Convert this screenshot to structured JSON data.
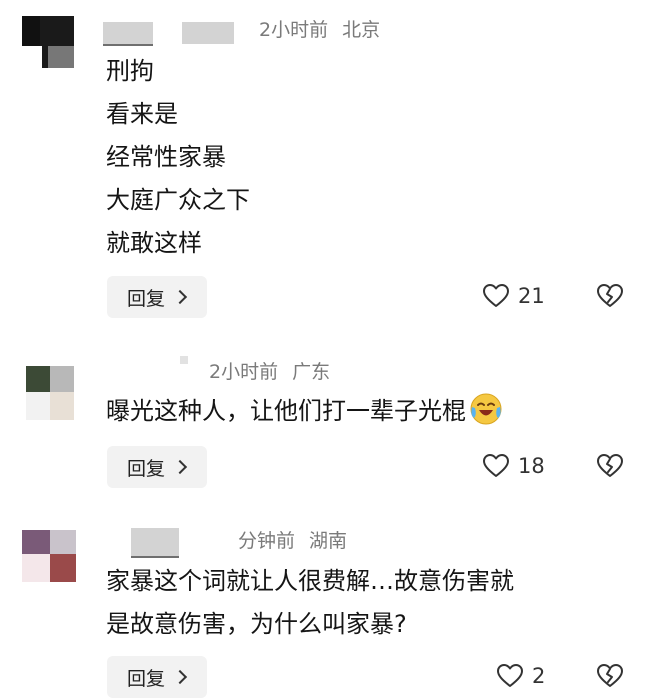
{
  "comments": [
    {
      "time": "2小时前",
      "location": "北京",
      "lines": [
        "刑拘",
        "看来是",
        "经常性家暴",
        "大庭广众之下",
        "就敢这样"
      ],
      "reply_label": "回复",
      "likes": "21"
    },
    {
      "time": "2小时前",
      "location": "广东",
      "lines": [
        "曝光这种人，让他们打一辈子光棍"
      ],
      "reply_label": "回复",
      "likes": "18",
      "emoji": "crying-laughing-emoji"
    },
    {
      "time": "分钟前",
      "location": "湖南",
      "lines": [
        "家暴这个词就让人很费解…故意伤害就",
        "是故意伤害，为什么叫家暴?"
      ],
      "reply_label": "回复",
      "likes": "2"
    }
  ],
  "icons": {
    "like": "heart-outline-icon",
    "dislike": "broken-heart-icon",
    "reply_arrow": "chevron-right-icon"
  }
}
